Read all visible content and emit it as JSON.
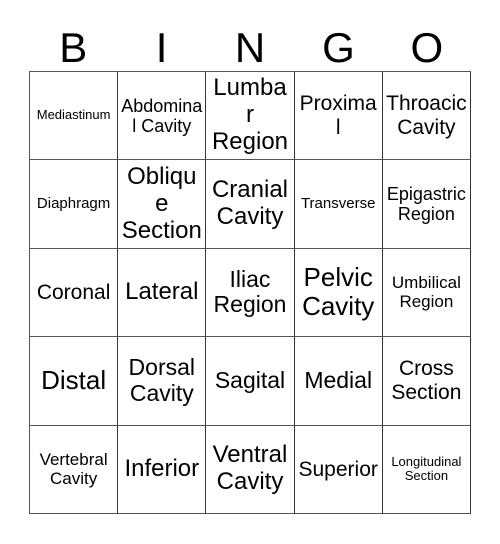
{
  "card": {
    "title_letters": [
      "B",
      "I",
      "N",
      "G",
      "O"
    ],
    "border_color": "#555555",
    "text_color": "#000000",
    "background_color": "#ffffff",
    "rows": 5,
    "columns": 5,
    "cells": [
      [
        {
          "label": "Mediastinum",
          "size": "fs-xs"
        },
        {
          "label": "Abdominal Cavity",
          "size": "fs-ml"
        },
        {
          "label": "Lumbar Region",
          "size": "fs-xxl"
        },
        {
          "label": "Proximal",
          "size": "fs-l"
        },
        {
          "label": "Throacic Cavity",
          "size": "fs-l"
        }
      ],
      [
        {
          "label": "Diaphragm",
          "size": "fs-s"
        },
        {
          "label": "Oblique Section",
          "size": "fs-xxl"
        },
        {
          "label": "Cranial Cavity",
          "size": "fs-xxl"
        },
        {
          "label": "Transverse",
          "size": "fs-s"
        },
        {
          "label": "Epigastric Region",
          "size": "fs-ml"
        }
      ],
      [
        {
          "label": "Coronal",
          "size": "fs-l"
        },
        {
          "label": "Lateral",
          "size": "fs-xxl"
        },
        {
          "label": "Iliac Region",
          "size": "fs-xl"
        },
        {
          "label": "Pelvic Cavity",
          "size": "fs-huge"
        },
        {
          "label": "Umbilical Region",
          "size": "fs-m"
        }
      ],
      [
        {
          "label": "Distal",
          "size": "fs-huge"
        },
        {
          "label": "Dorsal Cavity",
          "size": "fs-xl"
        },
        {
          "label": "Sagital",
          "size": "fs-xl"
        },
        {
          "label": "Medial",
          "size": "fs-xl"
        },
        {
          "label": "Cross Section",
          "size": "fs-l"
        }
      ],
      [
        {
          "label": "Vertebral Cavity",
          "size": "fs-m"
        },
        {
          "label": "Inferior",
          "size": "fs-xxl"
        },
        {
          "label": "Ventral Cavity",
          "size": "fs-xxl"
        },
        {
          "label": "Superior",
          "size": "fs-l"
        },
        {
          "label": "Longitudinal Section",
          "size": "fs-xs"
        }
      ]
    ]
  }
}
